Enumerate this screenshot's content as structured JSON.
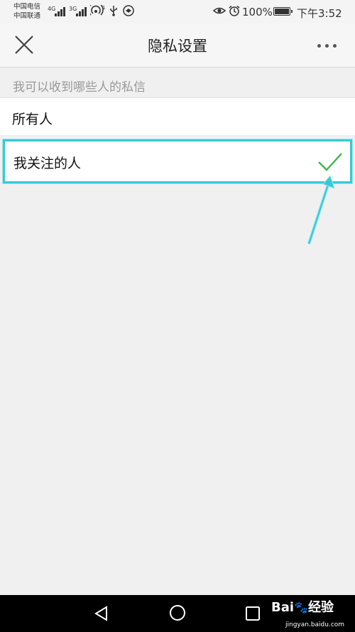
{
  "status_bar": {
    "carrier_1": "中国电信",
    "carrier_2": "中国联通",
    "sim1_network": "4G",
    "sim2_network": "3G",
    "battery_percent": "100%",
    "time": "下午3:52"
  },
  "header": {
    "title": "隐私设置"
  },
  "section": {
    "label": "我可以收到哪些人的私信"
  },
  "options": [
    {
      "label": "所有人",
      "selected": false
    },
    {
      "label": "我关注的人",
      "selected": true
    }
  ],
  "accent_color": "#35c9d6",
  "check_color": "#3eb84c",
  "watermark": {
    "brand": "Bai",
    "brand_suffix": "经验",
    "url": "jingyan.baidu.com"
  }
}
